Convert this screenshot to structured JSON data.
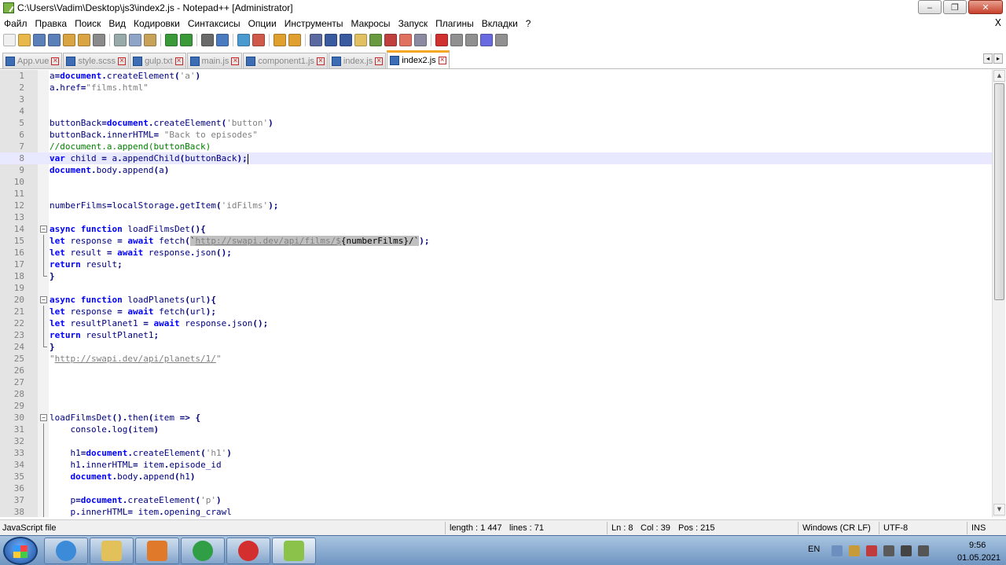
{
  "window": {
    "title": "C:\\Users\\Vadim\\Desktop\\js3\\index2.js - Notepad++ [Administrator]",
    "minimize": "‒",
    "restore": "❐",
    "close": "✕"
  },
  "menu": {
    "items": [
      "Файл",
      "Правка",
      "Поиск",
      "Вид",
      "Кодировки",
      "Синтаксисы",
      "Опции",
      "Инструменты",
      "Макросы",
      "Запуск",
      "Плагины",
      "Вкладки",
      "?"
    ],
    "close": "X"
  },
  "toolbar": {
    "buttons": [
      {
        "icon": "new-file-icon",
        "color": "#f0f0f0"
      },
      {
        "icon": "open-file-icon",
        "color": "#e8b84a"
      },
      {
        "icon": "save-icon",
        "color": "#5b7fb8"
      },
      {
        "icon": "save-all-icon",
        "color": "#5b7fb8"
      },
      {
        "icon": "close-icon",
        "color": "#d9a441"
      },
      {
        "icon": "close-all-icon",
        "color": "#d9a441"
      },
      {
        "icon": "print-icon",
        "color": "#8a8a8a"
      },
      {
        "sep": true
      },
      {
        "icon": "cut-icon",
        "color": "#9aa"
      },
      {
        "icon": "copy-icon",
        "color": "#8fa4c6"
      },
      {
        "icon": "paste-icon",
        "color": "#c9a25a"
      },
      {
        "sep": true
      },
      {
        "icon": "undo-icon",
        "color": "#3a9a3a"
      },
      {
        "icon": "redo-icon",
        "color": "#3a9a3a"
      },
      {
        "sep": true
      },
      {
        "icon": "find-icon",
        "color": "#6a6a6a"
      },
      {
        "icon": "replace-icon",
        "color": "#4a7ac0"
      },
      {
        "sep": true
      },
      {
        "icon": "zoom-in-icon",
        "color": "#4a9ad0"
      },
      {
        "icon": "zoom-out-icon",
        "color": "#d05a4a"
      },
      {
        "sep": true
      },
      {
        "icon": "sync-vertical-icon",
        "color": "#e0a030"
      },
      {
        "icon": "sync-horizontal-icon",
        "color": "#e0a030"
      },
      {
        "sep": true
      },
      {
        "icon": "word-wrap-icon",
        "color": "#5a6aa0"
      },
      {
        "icon": "show-all-chars-icon",
        "color": "#3a5aa0"
      },
      {
        "icon": "indent-guide-icon",
        "color": "#3a5aa0"
      },
      {
        "icon": "udl-icon",
        "color": "#e0c060"
      },
      {
        "icon": "doc-map-icon",
        "color": "#6a9a40"
      },
      {
        "icon": "function-list-icon",
        "color": "#c04040"
      },
      {
        "icon": "folder-workspace-icon",
        "color": "#e07060"
      },
      {
        "icon": "monitoring-icon",
        "color": "#8a8aa0"
      },
      {
        "sep": true
      },
      {
        "icon": "record-macro-icon",
        "color": "#d03030"
      },
      {
        "icon": "stop-macro-icon",
        "color": "#909090"
      },
      {
        "icon": "play-macro-icon",
        "color": "#909090"
      },
      {
        "icon": "run-macro-multiple-icon",
        "color": "#6a6ae0"
      },
      {
        "icon": "save-macro-icon",
        "color": "#909090"
      }
    ]
  },
  "tabs": [
    {
      "label": "App.vue",
      "active": false
    },
    {
      "label": "style.scss",
      "active": false
    },
    {
      "label": "gulp.txt",
      "active": false
    },
    {
      "label": "main.js",
      "active": false
    },
    {
      "label": "component1.js",
      "active": false
    },
    {
      "label": "index.js",
      "active": false
    },
    {
      "label": "index2.js",
      "active": true
    }
  ],
  "tab_arrows": {
    "left": "◂",
    "right": "▸"
  },
  "editor": {
    "current_line": 8,
    "lines": [
      {
        "n": "1",
        "segs": [
          [
            "id",
            "a"
          ],
          [
            "op",
            "="
          ],
          [
            "kw",
            "document"
          ],
          [
            "op",
            "."
          ],
          [
            "id",
            "createElement"
          ],
          [
            "op",
            "("
          ],
          [
            "str",
            "'a'"
          ],
          [
            "op",
            ")"
          ]
        ]
      },
      {
        "n": "2",
        "segs": [
          [
            "id",
            "a"
          ],
          [
            "op",
            "."
          ],
          [
            "id",
            "href"
          ],
          [
            "op",
            "="
          ],
          [
            "str",
            "\"films.html\""
          ]
        ]
      },
      {
        "n": "3",
        "segs": []
      },
      {
        "n": "4",
        "segs": []
      },
      {
        "n": "5",
        "segs": [
          [
            "id",
            "buttonBack"
          ],
          [
            "op",
            "="
          ],
          [
            "kw",
            "document"
          ],
          [
            "op",
            "."
          ],
          [
            "id",
            "createElement"
          ],
          [
            "op",
            "("
          ],
          [
            "str",
            "'button'"
          ],
          [
            "op",
            ")"
          ]
        ]
      },
      {
        "n": "6",
        "segs": [
          [
            "id",
            "buttonBack"
          ],
          [
            "op",
            "."
          ],
          [
            "id",
            "innerHTML"
          ],
          [
            "op",
            "= "
          ],
          [
            "str",
            "\"Back to episodes\""
          ]
        ]
      },
      {
        "n": "7",
        "segs": [
          [
            "cm",
            "//document.a.append(buttonBack)"
          ]
        ]
      },
      {
        "n": "8",
        "segs": [
          [
            "kw",
            "var"
          ],
          [
            "id",
            " child "
          ],
          [
            "op",
            "="
          ],
          [
            "id",
            " a"
          ],
          [
            "op",
            "."
          ],
          [
            "id",
            "appendChild"
          ],
          [
            "op",
            "("
          ],
          [
            "id",
            "buttonBack"
          ],
          [
            "op",
            ")"
          ],
          [
            "op",
            ";"
          ]
        ]
      },
      {
        "n": "9",
        "segs": [
          [
            "kw",
            "document"
          ],
          [
            "op",
            "."
          ],
          [
            "id",
            "body"
          ],
          [
            "op",
            "."
          ],
          [
            "id",
            "append"
          ],
          [
            "op",
            "("
          ],
          [
            "id",
            "a"
          ],
          [
            "op",
            ")"
          ]
        ]
      },
      {
        "n": "10",
        "segs": []
      },
      {
        "n": "11",
        "segs": []
      },
      {
        "n": "12",
        "segs": [
          [
            "id",
            "numberFilms"
          ],
          [
            "op",
            "="
          ],
          [
            "id",
            "localStorage"
          ],
          [
            "op",
            "."
          ],
          [
            "id",
            "getItem"
          ],
          [
            "op",
            "("
          ],
          [
            "str",
            "'idFilms'"
          ],
          [
            "op",
            ");"
          ]
        ]
      },
      {
        "n": "13",
        "segs": []
      },
      {
        "n": "14",
        "fold": "start",
        "segs": [
          [
            "kw",
            "async"
          ],
          [
            "id",
            " "
          ],
          [
            "kw",
            "function"
          ],
          [
            "id",
            " loadFilmsDet"
          ],
          [
            "op",
            "(){"
          ]
        ]
      },
      {
        "n": "15",
        "fold": "mid",
        "segs": [
          [
            "kw",
            "let"
          ],
          [
            "id",
            " response "
          ],
          [
            "op",
            "="
          ],
          [
            "id",
            " "
          ],
          [
            "kw",
            "await"
          ],
          [
            "id",
            " fetch"
          ],
          [
            "op",
            "("
          ],
          [
            "hl",
            "`"
          ],
          [
            "hlurl",
            "http://swapi.dev/api/films/$"
          ],
          [
            "hl",
            "{numberFilms}/`"
          ],
          [
            "op",
            ");"
          ]
        ]
      },
      {
        "n": "16",
        "fold": "mid",
        "segs": [
          [
            "kw",
            "let"
          ],
          [
            "id",
            " result "
          ],
          [
            "op",
            "="
          ],
          [
            "id",
            " "
          ],
          [
            "kw",
            "await"
          ],
          [
            "id",
            " response"
          ],
          [
            "op",
            "."
          ],
          [
            "id",
            "json"
          ],
          [
            "op",
            "();"
          ]
        ]
      },
      {
        "n": "17",
        "fold": "mid",
        "segs": [
          [
            "kw",
            "return"
          ],
          [
            "id",
            " result"
          ],
          [
            "op",
            ";"
          ]
        ]
      },
      {
        "n": "18",
        "fold": "end",
        "segs": [
          [
            "op",
            "}"
          ]
        ]
      },
      {
        "n": "19",
        "segs": []
      },
      {
        "n": "20",
        "fold": "start",
        "segs": [
          [
            "kw",
            "async"
          ],
          [
            "id",
            " "
          ],
          [
            "kw",
            "function"
          ],
          [
            "id",
            " loadPlanets"
          ],
          [
            "op",
            "("
          ],
          [
            "id",
            "url"
          ],
          [
            "op",
            "){"
          ]
        ]
      },
      {
        "n": "21",
        "fold": "mid",
        "segs": [
          [
            "kw",
            "let"
          ],
          [
            "id",
            " response "
          ],
          [
            "op",
            "="
          ],
          [
            "id",
            " "
          ],
          [
            "kw",
            "await"
          ],
          [
            "id",
            " fetch"
          ],
          [
            "op",
            "("
          ],
          [
            "id",
            "url"
          ],
          [
            "op",
            ");"
          ]
        ]
      },
      {
        "n": "22",
        "fold": "mid",
        "segs": [
          [
            "kw",
            "let"
          ],
          [
            "id",
            " resultPlanet1 "
          ],
          [
            "op",
            "="
          ],
          [
            "id",
            " "
          ],
          [
            "kw",
            "await"
          ],
          [
            "id",
            " response"
          ],
          [
            "op",
            "."
          ],
          [
            "id",
            "json"
          ],
          [
            "op",
            "();"
          ]
        ]
      },
      {
        "n": "23",
        "fold": "mid",
        "segs": [
          [
            "kw",
            "return"
          ],
          [
            "id",
            " resultPlanet1"
          ],
          [
            "op",
            ";"
          ]
        ]
      },
      {
        "n": "24",
        "fold": "end",
        "segs": [
          [
            "op",
            "}"
          ]
        ]
      },
      {
        "n": "25",
        "segs": [
          [
            "str",
            "\""
          ],
          [
            "url",
            "http://swapi.dev/api/planets/1/"
          ],
          [
            "str",
            "\""
          ]
        ]
      },
      {
        "n": "26",
        "segs": []
      },
      {
        "n": "27",
        "segs": []
      },
      {
        "n": "28",
        "segs": []
      },
      {
        "n": "29",
        "segs": []
      },
      {
        "n": "30",
        "fold": "start",
        "segs": [
          [
            "id",
            "loadFilmsDet"
          ],
          [
            "op",
            "()."
          ],
          [
            "id",
            "then"
          ],
          [
            "op",
            "("
          ],
          [
            "id",
            "item "
          ],
          [
            "op",
            "=>"
          ],
          [
            "id",
            " "
          ],
          [
            "op",
            "{"
          ]
        ]
      },
      {
        "n": "31",
        "fold": "mid",
        "segs": [
          [
            "id",
            "    console"
          ],
          [
            "op",
            "."
          ],
          [
            "id",
            "log"
          ],
          [
            "op",
            "("
          ],
          [
            "id",
            "item"
          ],
          [
            "op",
            ")"
          ]
        ]
      },
      {
        "n": "32",
        "fold": "mid",
        "segs": []
      },
      {
        "n": "33",
        "fold": "mid",
        "segs": [
          [
            "id",
            "    h1"
          ],
          [
            "op",
            "="
          ],
          [
            "kw",
            "document"
          ],
          [
            "op",
            "."
          ],
          [
            "id",
            "createElement"
          ],
          [
            "op",
            "("
          ],
          [
            "str",
            "'h1'"
          ],
          [
            "op",
            ")"
          ]
        ]
      },
      {
        "n": "34",
        "fold": "mid",
        "segs": [
          [
            "id",
            "    h1"
          ],
          [
            "op",
            "."
          ],
          [
            "id",
            "innerHTML"
          ],
          [
            "op",
            "="
          ],
          [
            "id",
            " item"
          ],
          [
            "op",
            "."
          ],
          [
            "id",
            "episode_id"
          ]
        ]
      },
      {
        "n": "35",
        "fold": "mid",
        "segs": [
          [
            "id",
            "    "
          ],
          [
            "kw",
            "document"
          ],
          [
            "op",
            "."
          ],
          [
            "id",
            "body"
          ],
          [
            "op",
            "."
          ],
          [
            "id",
            "append"
          ],
          [
            "op",
            "("
          ],
          [
            "id",
            "h1"
          ],
          [
            "op",
            ")"
          ]
        ]
      },
      {
        "n": "36",
        "fold": "mid",
        "segs": []
      },
      {
        "n": "37",
        "fold": "mid",
        "segs": [
          [
            "id",
            "    p"
          ],
          [
            "op",
            "="
          ],
          [
            "kw",
            "document"
          ],
          [
            "op",
            "."
          ],
          [
            "id",
            "createElement"
          ],
          [
            "op",
            "("
          ],
          [
            "str",
            "'p'"
          ],
          [
            "op",
            ")"
          ]
        ]
      },
      {
        "n": "38",
        "fold": "mid",
        "segs": [
          [
            "id",
            "    p"
          ],
          [
            "op",
            "."
          ],
          [
            "id",
            "innerHTML"
          ],
          [
            "op",
            "="
          ],
          [
            "id",
            " item"
          ],
          [
            "op",
            "."
          ],
          [
            "id",
            "opening_crawl"
          ]
        ]
      }
    ]
  },
  "scrollbar": {
    "up": "▲",
    "down": "▼"
  },
  "status": {
    "filetype": "JavaScript file",
    "length": "length : 1 447",
    "lines": "lines : 71",
    "ln": "Ln : 8",
    "col": "Col : 39",
    "pos": "Pos : 215",
    "eol": "Windows (CR LF)",
    "encoding": "UTF-8",
    "mode": "INS"
  },
  "taskbar": {
    "apps": [
      {
        "name": "internet-explorer",
        "color": "#3b8bd8",
        "active": false
      },
      {
        "name": "file-explorer",
        "color": "#e2c05a",
        "active": false
      },
      {
        "name": "media-player",
        "color": "#e07a2a",
        "active": false
      },
      {
        "name": "chrome",
        "color": "#2f9e44",
        "active": false
      },
      {
        "name": "opera",
        "color": "#d32f2f",
        "active": false
      },
      {
        "name": "notepad-plus-plus",
        "color": "#8bc34a",
        "active": true
      }
    ],
    "lang": "EN",
    "time": "9:56",
    "date": "01.05.2021"
  }
}
